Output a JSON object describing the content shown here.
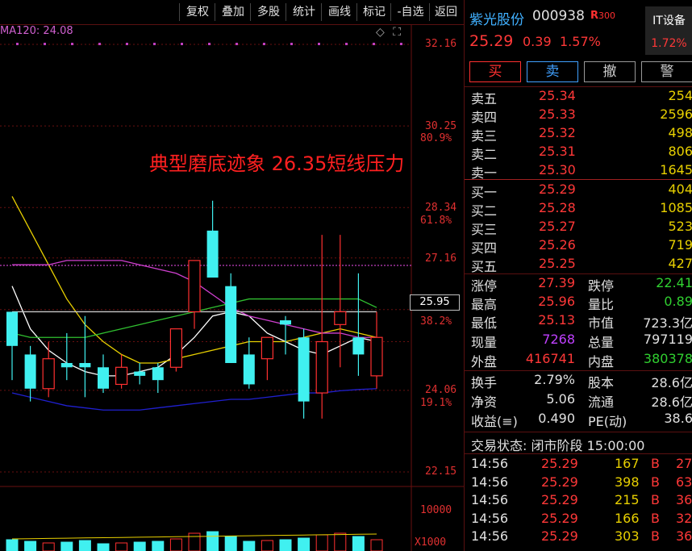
{
  "toolbar": {
    "items": [
      "复权",
      "叠加",
      "多股",
      "统计",
      "画线",
      "标记",
      "-自选",
      "返回"
    ]
  },
  "ma_label": "MA120: 24.08",
  "price_axis": {
    "labels": [
      {
        "text": "32.16",
        "color": "#e03030"
      },
      {
        "text": "30.25",
        "color": "#e03030"
      },
      {
        "text": "80.9%",
        "color": "#e03030"
      },
      {
        "text": "28.34",
        "color": "#e03030"
      },
      {
        "text": "61.8%",
        "color": "#e03030"
      },
      {
        "text": "27.16",
        "color": "#e03030"
      },
      {
        "text": "25.95",
        "color": "#e03030"
      },
      {
        "text": "38.2%",
        "color": "#e03030"
      },
      {
        "text": "24.06",
        "color": "#e03030"
      },
      {
        "text": "19.1%",
        "color": "#e03030"
      },
      {
        "text": "22.15",
        "color": "#e03030"
      },
      {
        "text": "10000",
        "color": "#e03030"
      },
      {
        "text": "X1000",
        "color": "#e03030"
      }
    ],
    "current_price_box": "25.95"
  },
  "annotation": "典型磨底迹象  26.35短线压力",
  "chart_data": {
    "type": "candlestick",
    "y_range": [
      21.5,
      33.0
    ],
    "candles": [
      {
        "o": 25.1,
        "h": 25.7,
        "l": 24.3,
        "c": 25.9,
        "up": false
      },
      {
        "o": 24.9,
        "h": 25.1,
        "l": 23.8,
        "c": 24.1,
        "up": false
      },
      {
        "o": 24.1,
        "h": 25.2,
        "l": 23.9,
        "c": 24.8,
        "up": true
      },
      {
        "o": 24.7,
        "h": 25.4,
        "l": 24.3,
        "c": 24.6,
        "up": false
      },
      {
        "o": 24.6,
        "h": 25.8,
        "l": 23.9,
        "c": 24.7,
        "up": false
      },
      {
        "o": 24.6,
        "h": 24.9,
        "l": 24.0,
        "c": 24.1,
        "up": false
      },
      {
        "o": 24.2,
        "h": 24.9,
        "l": 24.1,
        "c": 24.6,
        "up": true
      },
      {
        "o": 24.4,
        "h": 24.7,
        "l": 24.2,
        "c": 24.5,
        "up": false
      },
      {
        "o": 24.3,
        "h": 24.7,
        "l": 24.0,
        "c": 24.6,
        "up": false
      },
      {
        "o": 24.6,
        "h": 25.5,
        "l": 24.5,
        "c": 25.5,
        "up": true
      },
      {
        "o": 25.9,
        "h": 26.7,
        "l": 25.5,
        "c": 27.1,
        "up": true
      },
      {
        "o": 27.8,
        "h": 28.5,
        "l": 26.8,
        "c": 26.7,
        "up": false
      },
      {
        "o": 26.5,
        "h": 26.8,
        "l": 24.7,
        "c": 24.7,
        "up": false
      },
      {
        "o": 24.9,
        "h": 25.3,
        "l": 24.1,
        "c": 24.2,
        "up": false
      },
      {
        "o": 24.8,
        "h": 25.3,
        "l": 24.3,
        "c": 25.3,
        "up": true
      },
      {
        "o": 25.7,
        "h": 25.8,
        "l": 24.9,
        "c": 25.6,
        "up": false
      },
      {
        "o": 25.3,
        "h": 25.5,
        "l": 23.4,
        "c": 23.8,
        "up": false
      },
      {
        "o": 24.0,
        "h": 27.7,
        "l": 23.4,
        "c": 25.2,
        "up": true
      },
      {
        "o": 25.6,
        "h": 27.7,
        "l": 24.6,
        "c": 25.9,
        "up": true
      },
      {
        "o": 25.3,
        "h": 26.8,
        "l": 24.4,
        "c": 24.9,
        "up": false
      },
      {
        "o": 24.4,
        "h": 25.9,
        "l": 24.1,
        "c": 25.3,
        "up": true
      }
    ],
    "levels": [
      {
        "price": 32.16,
        "label": "32.16"
      },
      {
        "price": 30.25,
        "label": "80.9%"
      },
      {
        "price": 28.34,
        "label": "61.8%"
      },
      {
        "price": 27.16,
        "label": "27.16"
      },
      {
        "price": 25.95,
        "label": "25.95"
      },
      {
        "price": 25.2,
        "label": "38.2%"
      },
      {
        "price": 24.06,
        "label": "19.1%"
      },
      {
        "price": 22.15,
        "label": "22.15"
      }
    ],
    "ma_lines": [
      {
        "name": "MA5",
        "color": "#ffffff",
        "values": [
          26.5,
          25.5,
          25.0,
          24.7,
          24.5,
          24.4,
          24.4,
          24.5,
          24.6,
          24.9,
          25.3,
          25.8,
          25.9,
          25.8,
          25.4,
          25.2,
          25.0,
          24.9,
          25.1,
          25.3,
          25.2
        ]
      },
      {
        "name": "MA10",
        "color": "#e8d000",
        "values": [
          28.6,
          27.8,
          27.0,
          26.2,
          25.6,
          25.2,
          24.9,
          24.7,
          24.7,
          24.8,
          24.9,
          25.0,
          25.1,
          25.2,
          25.2,
          25.2,
          25.3,
          25.4,
          25.5,
          25.4,
          25.3
        ]
      },
      {
        "name": "MA20",
        "color": "#d040d0",
        "values": [
          27.0,
          27.0,
          27.0,
          27.1,
          27.1,
          27.1,
          27.1,
          27.0,
          26.9,
          26.8,
          26.6,
          26.3,
          26.0,
          25.8,
          25.7,
          25.6,
          25.5,
          25.4,
          25.4,
          25.3,
          25.3
        ]
      },
      {
        "name": "MA30",
        "color": "#30c030",
        "values": [
          25.4,
          25.3,
          25.3,
          25.3,
          25.3,
          25.4,
          25.5,
          25.6,
          25.7,
          25.8,
          25.9,
          26.0,
          26.1,
          26.2,
          26.2,
          26.2,
          26.2,
          26.2,
          26.2,
          26.2,
          26.0
        ]
      },
      {
        "name": "MA60",
        "color": "#c8c8c8",
        "values": [
          25.9,
          25.9,
          25.9,
          25.9,
          25.9,
          25.9,
          25.9,
          25.9,
          25.9,
          25.9,
          25.9,
          25.9,
          25.9,
          25.9,
          25.9,
          25.9,
          25.9,
          25.9,
          25.9,
          25.9,
          25.9
        ]
      },
      {
        "name": "MA120",
        "color": "#2020d0",
        "values": [
          24.0,
          23.9,
          23.8,
          23.7,
          23.65,
          23.6,
          23.6,
          23.6,
          23.65,
          23.7,
          23.75,
          23.8,
          23.85,
          23.85,
          23.9,
          23.95,
          24.0,
          24.0,
          24.05,
          24.08,
          24.1
        ]
      }
    ]
  },
  "stock": {
    "name": "紫光股份",
    "code": "000938",
    "r_mark": "R",
    "r_sub": "300",
    "price": "25.29",
    "change": "0.39",
    "change_pct": "1.57%",
    "sector_name": "IT设备",
    "sector_pct": "1.72%"
  },
  "trade_buttons": {
    "buy": "买",
    "sell": "卖",
    "cancel": "撤",
    "alert": "警"
  },
  "asks": [
    {
      "label": "卖五",
      "price": "25.34",
      "vol": "254"
    },
    {
      "label": "卖四",
      "price": "25.33",
      "vol": "2596"
    },
    {
      "label": "卖三",
      "price": "25.32",
      "vol": "498"
    },
    {
      "label": "卖二",
      "price": "25.31",
      "vol": "806"
    },
    {
      "label": "卖一",
      "price": "25.30",
      "vol": "1645"
    }
  ],
  "bids": [
    {
      "label": "买一",
      "price": "25.29",
      "vol": "404"
    },
    {
      "label": "买二",
      "price": "25.28",
      "vol": "1085"
    },
    {
      "label": "买三",
      "price": "25.27",
      "vol": "523"
    },
    {
      "label": "买四",
      "price": "25.26",
      "vol": "719"
    },
    {
      "label": "买五",
      "price": "25.25",
      "vol": "427"
    }
  ],
  "stats": {
    "limit_up_label": "涨停",
    "limit_up": "27.39",
    "limit_down_label": "跌停",
    "limit_down": "22.41",
    "high_label": "最高",
    "high": "25.96",
    "vol_ratio_label": "量比",
    "vol_ratio": "0.89",
    "low_label": "最低",
    "low": "25.13",
    "mkt_cap_label": "市值",
    "mkt_cap": "723.3亿",
    "cur_vol_label": "现量",
    "cur_vol": "7268",
    "total_vol_label": "总量",
    "total_vol": "797119",
    "outer_label": "外盘",
    "outer": "416741",
    "inner_label": "内盘",
    "inner": "380378",
    "turnover_label": "换手",
    "turnover": "2.79%",
    "shares_label": "股本",
    "shares": "28.6亿",
    "nav_label": "净资",
    "nav": "5.06",
    "float_label": "流通",
    "float": "28.6亿",
    "eps_label": "收益(≡)",
    "eps": "0.490",
    "pe_label": "PE(动)",
    "pe": "38.6"
  },
  "trade_status": "交易状态: 闭市阶段 15:00:00",
  "ticks": [
    {
      "time": "14:56",
      "price": "25.29",
      "vol": "167",
      "side": "B",
      "extra": "27"
    },
    {
      "time": "14:56",
      "price": "25.29",
      "vol": "398",
      "side": "B",
      "extra": "63"
    },
    {
      "time": "14:56",
      "price": "25.29",
      "vol": "215",
      "side": "B",
      "extra": "36"
    },
    {
      "time": "14:56",
      "price": "25.29",
      "vol": "166",
      "side": "B",
      "extra": "32"
    },
    {
      "time": "14:56",
      "price": "25.29",
      "vol": "303",
      "side": "B",
      "extra": "36"
    }
  ]
}
